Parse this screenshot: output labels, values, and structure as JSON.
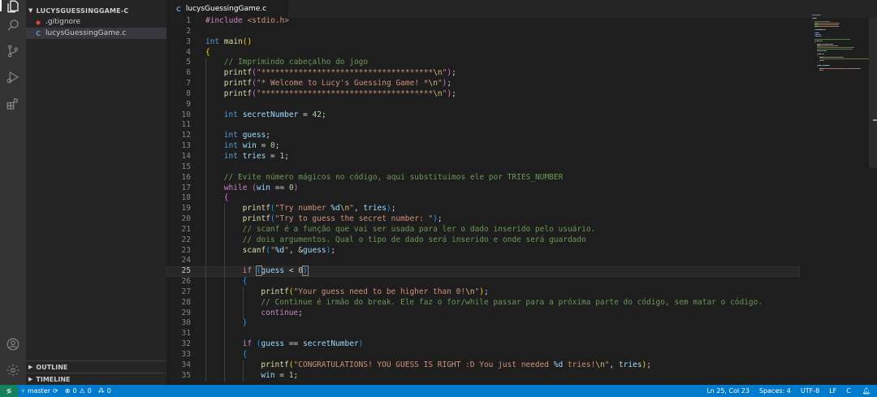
{
  "explorer": {
    "folder_name": "LUCYSGUESSINGGAME-C",
    "files": [
      {
        "name": ".gitignore",
        "icon": "git-icon"
      },
      {
        "name": "lucysGuessingGame.c",
        "icon": "c-file-icon"
      }
    ],
    "outline_label": "OUTLINE",
    "timeline_label": "TIMELINE"
  },
  "tab": {
    "label": "lucysGuessingGame.c",
    "icon_glyph": "C"
  },
  "status": {
    "branch": "master",
    "errors": "0",
    "warnings": "0",
    "ports": "0",
    "position": "Ln 25, Col 23",
    "spaces": "Spaces: 4",
    "encoding": "UTF-8",
    "eol": "LF",
    "language": "C"
  },
  "editor": {
    "current_line": 25,
    "lines": [
      {
        "n": "1",
        "indent": 0,
        "code": [
          [
            "kw2",
            "#include "
          ],
          [
            "str",
            "<stdio.h>"
          ]
        ]
      },
      {
        "n": "2",
        "indent": 0,
        "code": []
      },
      {
        "n": "3",
        "indent": 0,
        "code": [
          [
            "kw",
            "int "
          ],
          [
            "fn",
            "main"
          ],
          [
            "br1",
            "()"
          ]
        ]
      },
      {
        "n": "4",
        "indent": 0,
        "code": [
          [
            "br1",
            "{"
          ]
        ]
      },
      {
        "n": "5",
        "indent": 1,
        "code": [
          [
            "cmt",
            "// Imprimindo cabeçalho do jogo"
          ]
        ]
      },
      {
        "n": "6",
        "indent": 1,
        "code": [
          [
            "fn",
            "printf"
          ],
          [
            "br2",
            "("
          ],
          [
            "str",
            "\"*************************************"
          ],
          [
            "esc",
            "\\n"
          ],
          [
            "str",
            "\""
          ],
          [
            "br2",
            ")"
          ],
          [
            "",
            "; "
          ]
        ]
      },
      {
        "n": "7",
        "indent": 1,
        "code": [
          [
            "fn",
            "printf"
          ],
          [
            "br2",
            "("
          ],
          [
            "str",
            "\"* Welcome to Lucy's Guessing Game! *"
          ],
          [
            "esc",
            "\\n"
          ],
          [
            "str",
            "\""
          ],
          [
            "br2",
            ")"
          ],
          [
            ";",
            ";"
          ]
        ]
      },
      {
        "n": "8",
        "indent": 1,
        "code": [
          [
            "fn",
            "printf"
          ],
          [
            "br2",
            "("
          ],
          [
            "str",
            "\"*************************************"
          ],
          [
            "esc",
            "\\n"
          ],
          [
            "str",
            "\""
          ],
          [
            "br2",
            ")"
          ],
          [
            "",
            ";"
          ]
        ]
      },
      {
        "n": "9",
        "indent": 1,
        "code": []
      },
      {
        "n": "10",
        "indent": 1,
        "code": [
          [
            "kw",
            "int "
          ],
          [
            "var",
            "secretNumber"
          ],
          [
            "",
            " = "
          ],
          [
            "num",
            "42"
          ],
          [
            "",
            ";"
          ]
        ]
      },
      {
        "n": "11",
        "indent": 1,
        "code": []
      },
      {
        "n": "12",
        "indent": 1,
        "code": [
          [
            "kw",
            "int "
          ],
          [
            "var",
            "guess"
          ],
          [
            "",
            ";"
          ]
        ]
      },
      {
        "n": "13",
        "indent": 1,
        "code": [
          [
            "kw",
            "int "
          ],
          [
            "var",
            "win"
          ],
          [
            "",
            " = "
          ],
          [
            "num",
            "0"
          ],
          [
            "",
            ";"
          ]
        ]
      },
      {
        "n": "14",
        "indent": 1,
        "code": [
          [
            "kw",
            "int "
          ],
          [
            "var",
            "tries"
          ],
          [
            "",
            " = "
          ],
          [
            "num",
            "1"
          ],
          [
            "",
            ";"
          ]
        ]
      },
      {
        "n": "15",
        "indent": 1,
        "code": []
      },
      {
        "n": "16",
        "indent": 1,
        "code": [
          [
            "cmt",
            "// Evite número mágicos no código, aqui substituimos ele por TRIES_NUMBER"
          ]
        ]
      },
      {
        "n": "17",
        "indent": 1,
        "code": [
          [
            "kw2",
            "while "
          ],
          [
            "br2",
            "("
          ],
          [
            "var",
            "win"
          ],
          [
            "",
            " == "
          ],
          [
            "num",
            "0"
          ],
          [
            "br2",
            ")"
          ]
        ]
      },
      {
        "n": "18",
        "indent": 1,
        "code": [
          [
            "br2",
            "{"
          ]
        ]
      },
      {
        "n": "19",
        "indent": 2,
        "code": [
          [
            "fn",
            "printf"
          ],
          [
            "br3",
            "("
          ],
          [
            "str",
            "\"Try number "
          ],
          [
            "var",
            "%d"
          ],
          [
            "esc",
            "\\n"
          ],
          [
            "str",
            "\""
          ],
          [
            "",
            ", "
          ],
          [
            "var",
            "tries"
          ],
          [
            "br3",
            ")"
          ],
          [
            "",
            ";"
          ]
        ]
      },
      {
        "n": "20",
        "indent": 2,
        "code": [
          [
            "fn",
            "printf"
          ],
          [
            "br3",
            "("
          ],
          [
            "str",
            "\"Try to guess the secret number: \""
          ],
          [
            "br3",
            ")"
          ],
          [
            "",
            ";"
          ]
        ]
      },
      {
        "n": "21",
        "indent": 2,
        "code": [
          [
            "cmt",
            "// scanf é a função que vai ser usada para ler o dado inserido pelo usuário."
          ]
        ]
      },
      {
        "n": "22",
        "indent": 2,
        "code": [
          [
            "cmt",
            "// dois argumentos. Qual o tipo de dado será inserido e onde será guardado"
          ]
        ]
      },
      {
        "n": "23",
        "indent": 2,
        "code": [
          [
            "fn",
            "scanf"
          ],
          [
            "br3",
            "("
          ],
          [
            "str",
            "\""
          ],
          [
            "var",
            "%d"
          ],
          [
            "str",
            "\""
          ],
          [
            "",
            ", &"
          ],
          [
            "var",
            "guess"
          ],
          [
            "br3",
            ")"
          ],
          [
            "",
            ";"
          ]
        ]
      },
      {
        "n": "24",
        "indent": 2,
        "code": []
      },
      {
        "n": "25",
        "indent": 2,
        "code": [
          [
            "kw2",
            "if "
          ],
          [
            "br3box",
            "("
          ],
          [
            "var",
            "guess"
          ],
          [
            "",
            " < "
          ],
          [
            "num",
            "0"
          ],
          [
            "br3box",
            ")"
          ],
          [
            "cursor",
            ""
          ]
        ]
      },
      {
        "n": "26",
        "indent": 2,
        "code": [
          [
            "br3",
            "{"
          ]
        ]
      },
      {
        "n": "27",
        "indent": 3,
        "code": [
          [
            "fn",
            "printf"
          ],
          [
            "br1",
            "("
          ],
          [
            "str",
            "\"Your guess need to be higher than 0!"
          ],
          [
            "esc",
            "\\n"
          ],
          [
            "str",
            "\""
          ],
          [
            "br1",
            ")"
          ],
          [
            "",
            ";"
          ]
        ]
      },
      {
        "n": "28",
        "indent": 3,
        "code": [
          [
            "cmt",
            "// Continue é irmão do break. Ele faz o for/while passar para a próxima parte do código, sem matar o código."
          ]
        ]
      },
      {
        "n": "29",
        "indent": 3,
        "code": [
          [
            "kw2",
            "continue"
          ],
          [
            "",
            ";"
          ]
        ]
      },
      {
        "n": "30",
        "indent": 2,
        "code": [
          [
            "br3",
            "}"
          ]
        ]
      },
      {
        "n": "31",
        "indent": 2,
        "code": []
      },
      {
        "n": "32",
        "indent": 2,
        "code": [
          [
            "kw2",
            "if "
          ],
          [
            "br3",
            "("
          ],
          [
            "var",
            "guess"
          ],
          [
            "",
            " == "
          ],
          [
            "var",
            "secretNumber"
          ],
          [
            "br3",
            ")"
          ]
        ]
      },
      {
        "n": "33",
        "indent": 2,
        "code": [
          [
            "br3",
            "{"
          ]
        ]
      },
      {
        "n": "34",
        "indent": 3,
        "code": [
          [
            "fn",
            "printf"
          ],
          [
            "br1",
            "("
          ],
          [
            "str",
            "\"CONGRATULATIONS! YOU GUESS IS RIGHT :D You just needed "
          ],
          [
            "var",
            "%d"
          ],
          [
            "str",
            " tries!"
          ],
          [
            "esc",
            "\\n"
          ],
          [
            "str",
            "\""
          ],
          [
            "",
            ", "
          ],
          [
            "var",
            "tries"
          ],
          [
            "br1",
            ")"
          ],
          [
            "",
            ";"
          ]
        ]
      },
      {
        "n": "35",
        "indent": 3,
        "code": [
          [
            "var",
            "win"
          ],
          [
            "",
            " = "
          ],
          [
            "num",
            "1"
          ],
          [
            "",
            ";"
          ]
        ]
      }
    ]
  },
  "colors": {
    "activity_bar": "#333333",
    "sidebar": "#252526",
    "editor_bg": "#1e1e1e",
    "status_bar": "#007acc",
    "remote_badge": "#16825d"
  }
}
